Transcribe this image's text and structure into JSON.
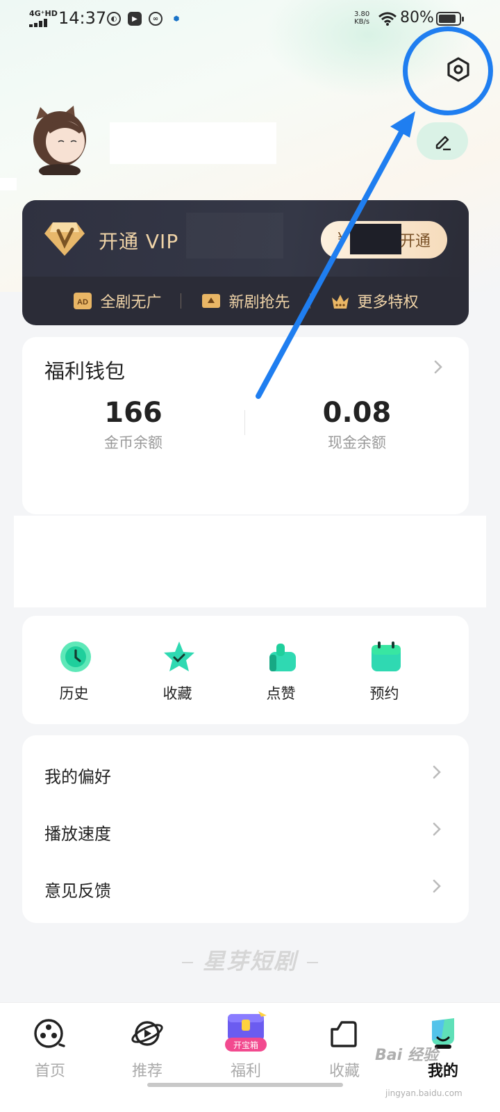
{
  "status_bar": {
    "network": "4G⁺HD",
    "time": "14:37",
    "speed_value": "3.80",
    "speed_unit": "KB/s",
    "battery": "80%"
  },
  "header": {
    "settings_icon": "settings-icon",
    "edit_icon": "edit-icon"
  },
  "vip": {
    "title": "开通 VIP",
    "open_button": "开通",
    "open_prefix": "¥",
    "benefits": [
      {
        "label": "全剧无广",
        "icon": "ad-free-icon"
      },
      {
        "label": "新剧抢先",
        "icon": "early-access-icon"
      },
      {
        "label": "更多特权",
        "icon": "crown-icon"
      }
    ]
  },
  "wallet": {
    "title": "福利钱包",
    "coins_value": "166",
    "coins_label": "金币余额",
    "cash_value": "0.08",
    "cash_label": "现金余额"
  },
  "actions": [
    {
      "label": "历史",
      "icon": "clock-icon"
    },
    {
      "label": "收藏",
      "icon": "star-icon"
    },
    {
      "label": "点赞",
      "icon": "thumbs-up-icon"
    },
    {
      "label": "预约",
      "icon": "calendar-icon"
    }
  ],
  "menu": [
    {
      "label": "我的偏好"
    },
    {
      "label": "播放速度"
    },
    {
      "label": "意见反馈"
    }
  ],
  "brand": "星芽短剧",
  "tabs": [
    {
      "label": "首页",
      "icon": "film-reel-icon"
    },
    {
      "label": "推荐",
      "icon": "planet-icon"
    },
    {
      "label": "福利",
      "icon": "treasure-box-icon",
      "badge": "开宝箱"
    },
    {
      "label": "收藏",
      "icon": "folder-icon"
    },
    {
      "label": "我的",
      "icon": "profile-icon",
      "active": true
    }
  ],
  "watermark": {
    "text": "Bai 经验",
    "sub": "jingyan.baidu.com"
  },
  "colors": {
    "accent": "#1f7ef0",
    "vip_gold": "#f0d4a8",
    "vip_bg": "#2b2c37",
    "mint": "#22d3a4"
  }
}
